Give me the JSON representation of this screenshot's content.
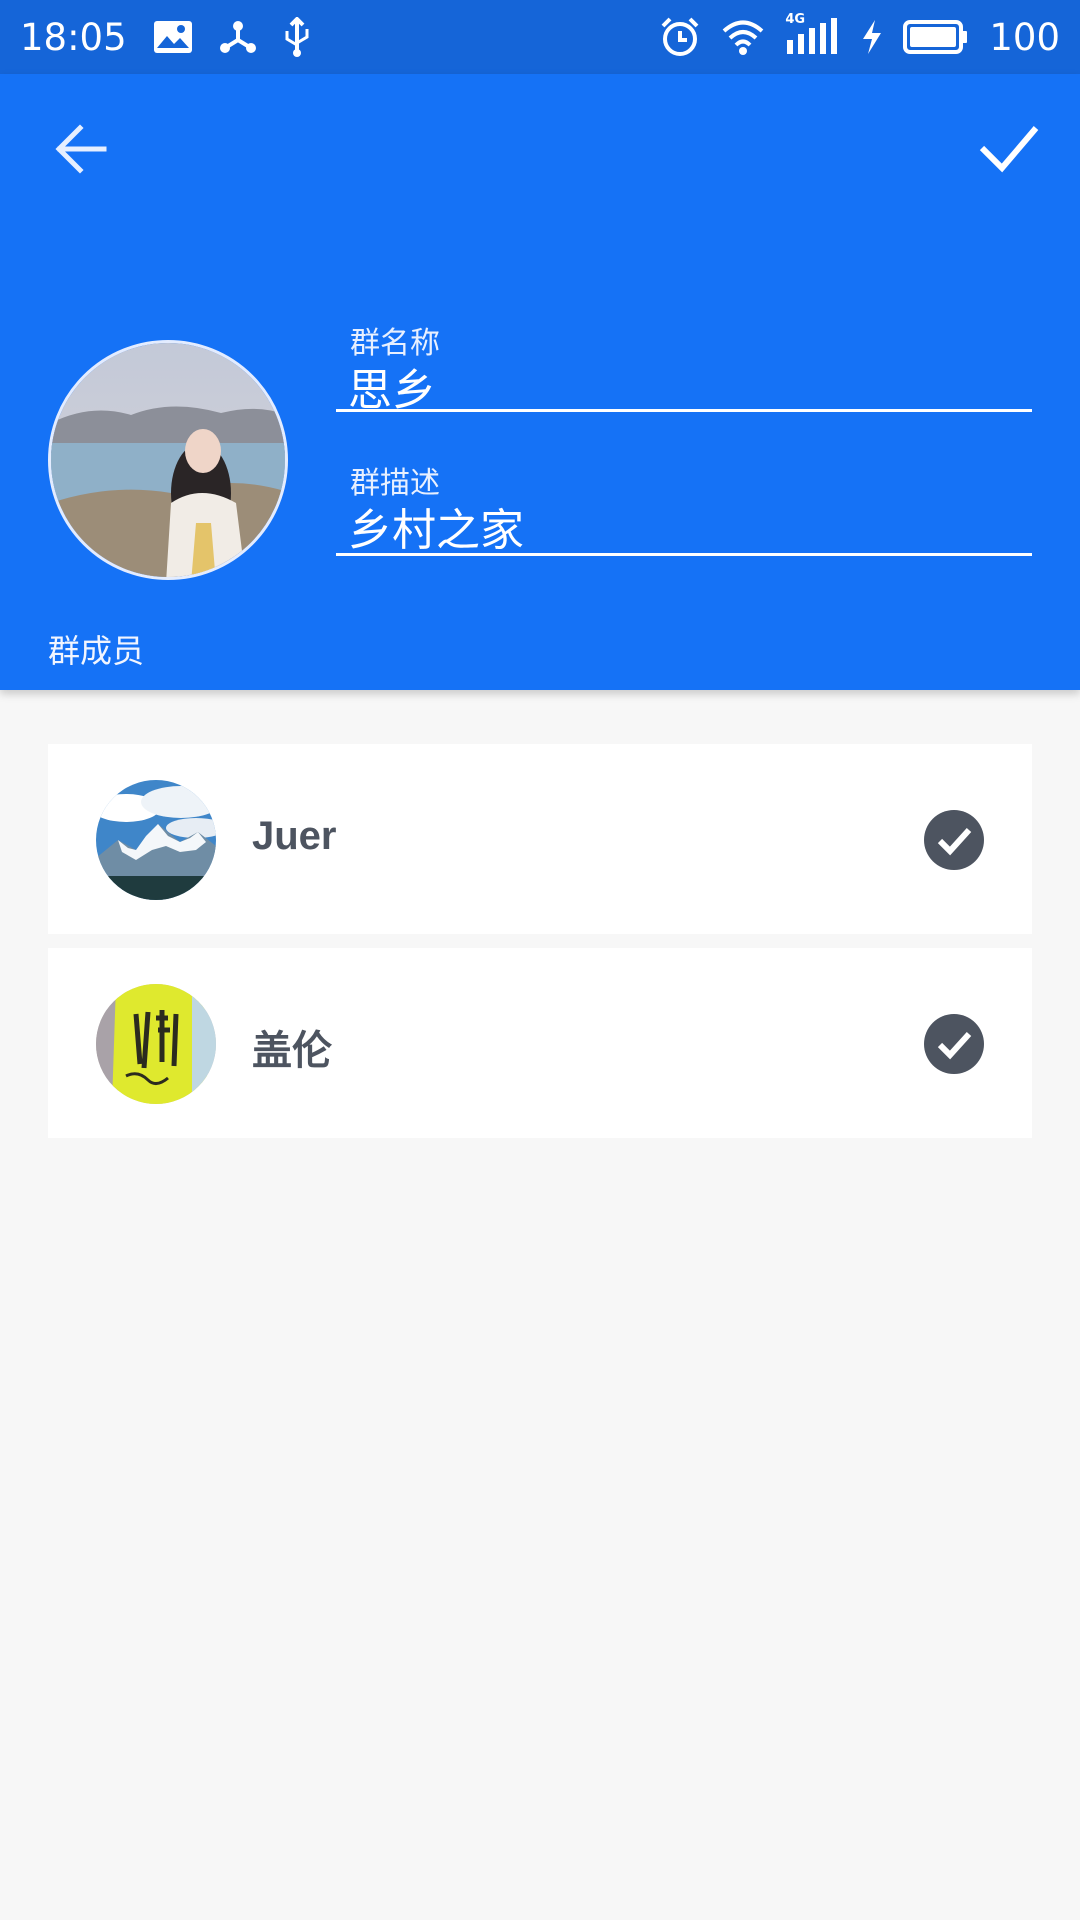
{
  "status_bar": {
    "time": "18:05",
    "battery_level": "100",
    "network_type": "4G",
    "left_icons": [
      "image-icon",
      "share-icon",
      "usb-icon"
    ],
    "right_icons": [
      "alarm-icon",
      "wifi-icon",
      "signal-icon",
      "charging-icon",
      "battery-icon"
    ]
  },
  "header": {
    "back_icon": "arrow-left-icon",
    "confirm_icon": "check-icon",
    "group_name_label": "群名称",
    "group_name_value": "思乡",
    "group_desc_label": "群描述",
    "group_desc_value": "乡村之家",
    "members_title": "群成员"
  },
  "members": [
    {
      "name": "Juer",
      "selected": true,
      "avatar": "mountain-photo"
    },
    {
      "name": "盖伦",
      "selected": true,
      "avatar": "yellow-cup-photo"
    }
  ],
  "colors": {
    "status_bar": "#1565d8",
    "header": "#1572f6",
    "background": "#f7f7f7",
    "check_circle": "#4d5460"
  }
}
